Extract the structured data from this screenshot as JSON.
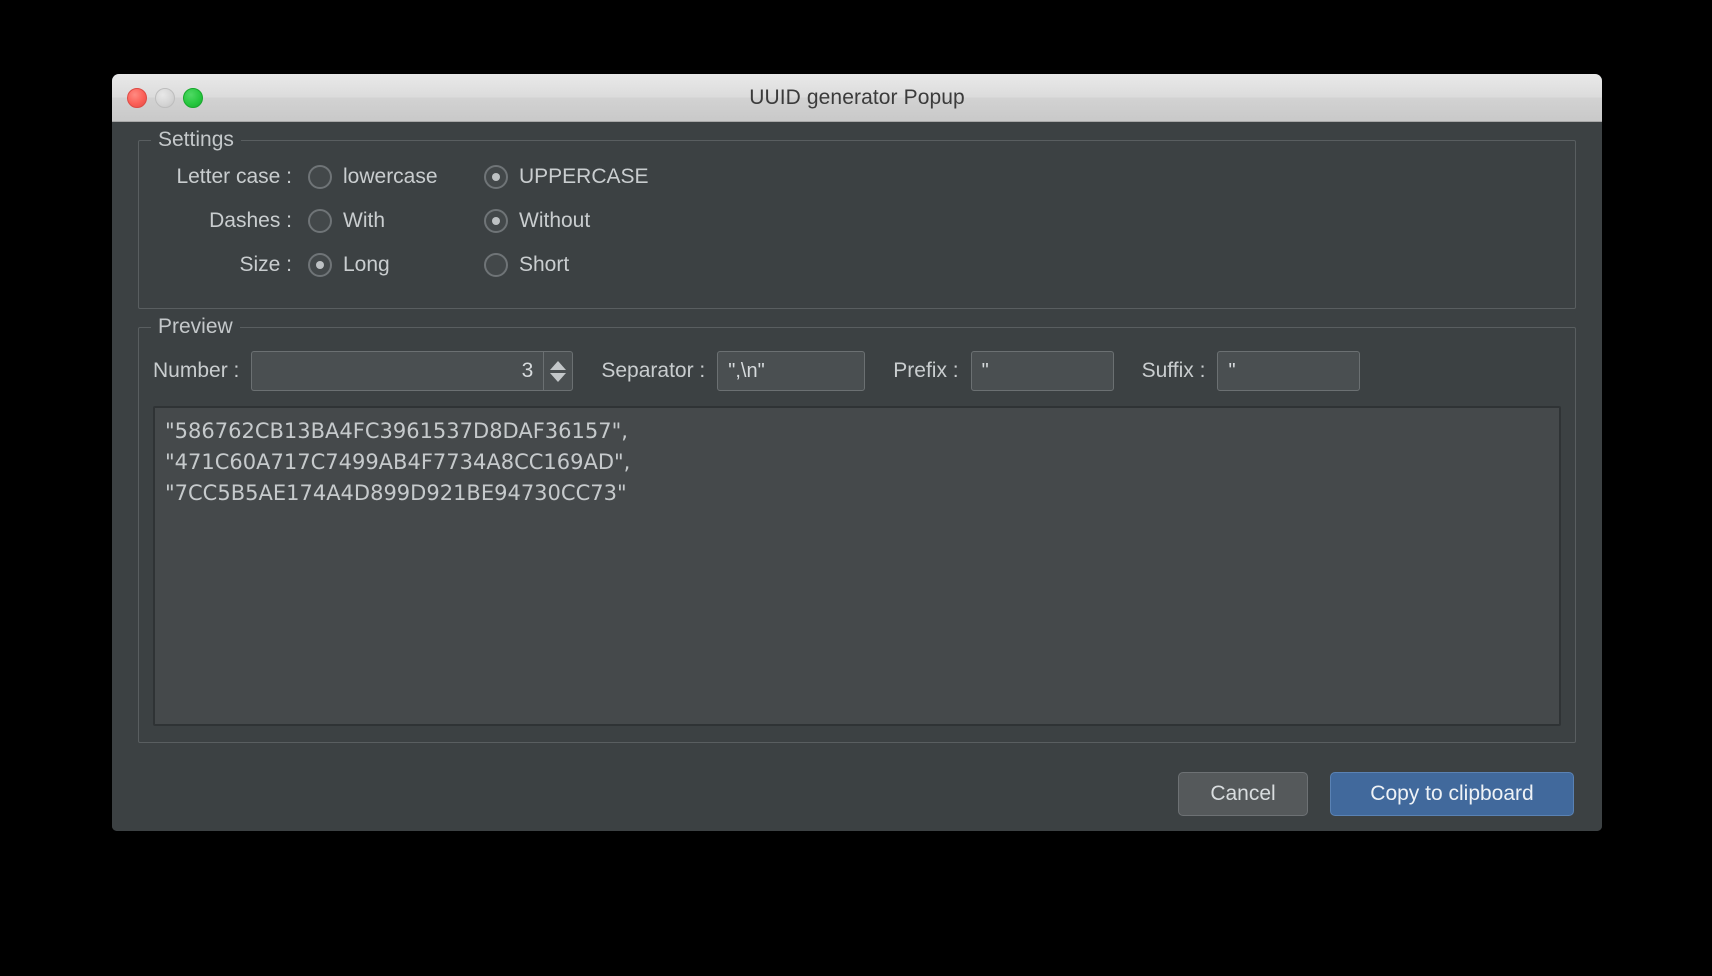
{
  "window": {
    "title": "UUID generator Popup",
    "traffic_lights": {
      "close": "close-button",
      "minimize": "minimize-button",
      "zoom": "zoom-button"
    }
  },
  "settings": {
    "legend": "Settings",
    "rows": [
      {
        "label": "Letter case :",
        "options": [
          {
            "label": "lowercase",
            "checked": false
          },
          {
            "label": "UPPERCASE",
            "checked": true
          }
        ]
      },
      {
        "label": "Dashes :",
        "options": [
          {
            "label": "With",
            "checked": false
          },
          {
            "label": "Without",
            "checked": true
          }
        ]
      },
      {
        "label": "Size :",
        "options": [
          {
            "label": "Long",
            "checked": true
          },
          {
            "label": "Short",
            "checked": false
          }
        ]
      }
    ]
  },
  "preview": {
    "legend": "Preview",
    "number_label": "Number :",
    "number_value": "3",
    "separator_label": "Separator :",
    "separator_value": "\",\\n\"",
    "prefix_label": "Prefix :",
    "prefix_value": "\"",
    "suffix_label": "Suffix :",
    "suffix_value": "\"",
    "output_text": "\"586762CB13BA4FC3961537D8DAF36157\",\n\"471C60A717C7499AB4F7734A8CC169AD\",\n\"7CC5B5AE174A4D899D921BE94730CC73\"",
    "output_lines": [
      "\"586762CB13BA4FC3961537D8DAF36157\",",
      "\"471C60A717C7499AB4F7734A8CC169AD\",",
      "\"7CC5B5AE174A4D899D921BE94730CC73\""
    ]
  },
  "footer": {
    "cancel_label": "Cancel",
    "copy_label": "Copy to clipboard"
  },
  "colors": {
    "window_bg": "#3c4143",
    "titlebar_bg": "#dcdcdc",
    "field_bg": "#4a4f51",
    "output_bg": "#45494b",
    "text": "#c9cdcf",
    "primary_button": "#41699c",
    "close_light": "#fb5f57",
    "minimize_light": "#d6d6d6",
    "zoom_light": "#28c840"
  }
}
